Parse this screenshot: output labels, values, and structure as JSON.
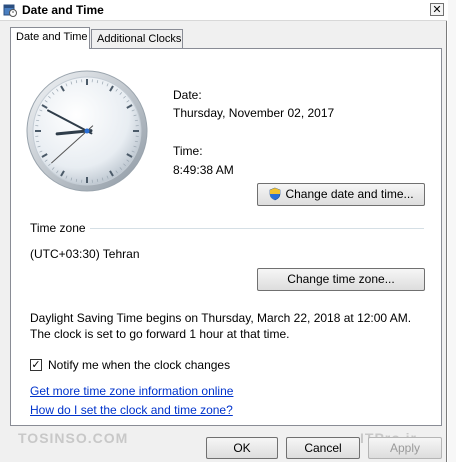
{
  "window": {
    "title": "Date and Time",
    "close_glyph": "✕"
  },
  "tabs": [
    {
      "label": "Date and Time",
      "active": true
    },
    {
      "label": "Additional Clocks",
      "active": false
    }
  ],
  "date": {
    "label": "Date:",
    "value": "Thursday, November 02, 2017"
  },
  "time": {
    "label": "Time:",
    "value": "8:49:38 AM"
  },
  "buttons": {
    "change_date_time": "Change date and time...",
    "change_time_zone": "Change time zone...",
    "ok": "OK",
    "cancel": "Cancel",
    "apply": "Apply"
  },
  "timezone": {
    "heading": "Time zone",
    "value": "(UTC+03:30) Tehran"
  },
  "dst_note": "Daylight Saving Time begins on Thursday, March 22, 2018 at 12:00 AM. The clock is set to go forward 1 hour at that time.",
  "notify": {
    "label": "Notify me when the clock changes",
    "checked": true,
    "check_glyph": "✓"
  },
  "links": {
    "more_info": "Get more time zone information online",
    "how_to_set": "How do I set the clock and time zone?"
  },
  "watermark": {
    "left": "TOSINSO.COM",
    "right": "ITPro.ir"
  },
  "clock": {
    "hour": 8,
    "minute": 49,
    "second": 38
  },
  "colors": {
    "link": "#0033cc",
    "accent_shield": "#2a6fd6"
  },
  "icons": {
    "app": "clock-calendar-icon",
    "shield": "uac-shield-icon",
    "close": "close-icon"
  }
}
